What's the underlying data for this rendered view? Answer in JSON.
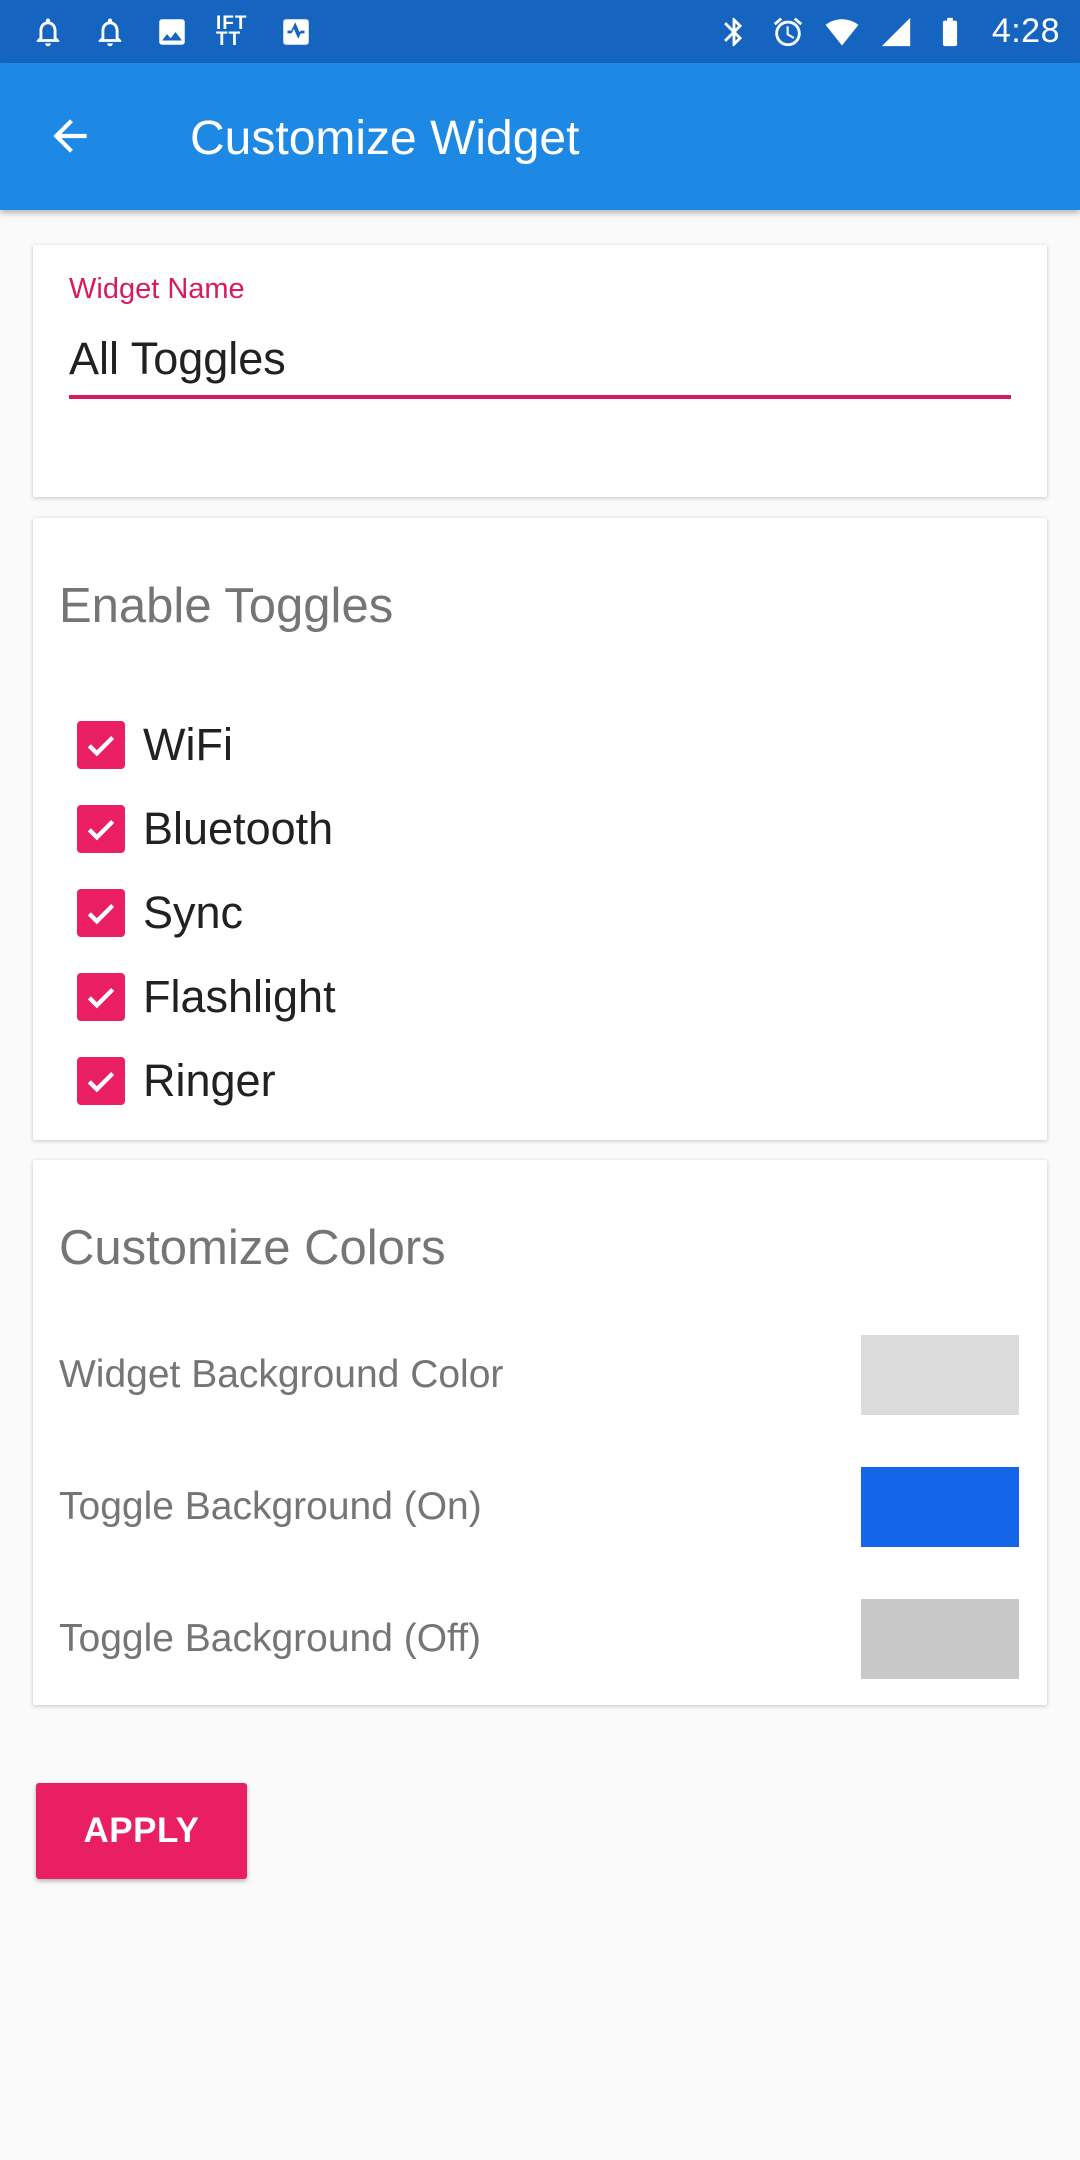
{
  "status_bar": {
    "time": "4:28",
    "ifttt_label": "IFT TT",
    "left_icons": [
      "bell-icon",
      "bell-icon",
      "image-icon",
      "ifttt-icon",
      "activity-icon"
    ],
    "right_icons": [
      "bluetooth-icon",
      "alarm-icon",
      "wifi-icon",
      "signal-icon",
      "battery-icon"
    ]
  },
  "app_bar": {
    "title": "Customize Widget",
    "back_icon": "arrow-back-icon"
  },
  "widget_name": {
    "label": "Widget Name",
    "value": "All Toggles",
    "accent_color": "#d81b60"
  },
  "toggles": {
    "title": "Enable Toggles",
    "items": [
      {
        "label": "WiFi",
        "checked": true
      },
      {
        "label": "Bluetooth",
        "checked": true
      },
      {
        "label": "Sync",
        "checked": true
      },
      {
        "label": "Flashlight",
        "checked": true
      },
      {
        "label": "Ringer",
        "checked": true
      }
    ],
    "checkbox_color": "#e91e63"
  },
  "colors": {
    "title": "Customize Colors",
    "rows": [
      {
        "label": "Widget Background Color",
        "swatch": "#dcdcdc"
      },
      {
        "label": "Toggle Background (On)",
        "swatch": "#1565e8"
      },
      {
        "label": "Toggle Background (Off)",
        "swatch": "#c8c8c8"
      }
    ]
  },
  "apply_button": {
    "label": "APPLY",
    "color": "#e91e63"
  },
  "theme": {
    "status_bar": "#1565c0",
    "app_bar": "#1e88e5",
    "background": "#fafafa"
  }
}
